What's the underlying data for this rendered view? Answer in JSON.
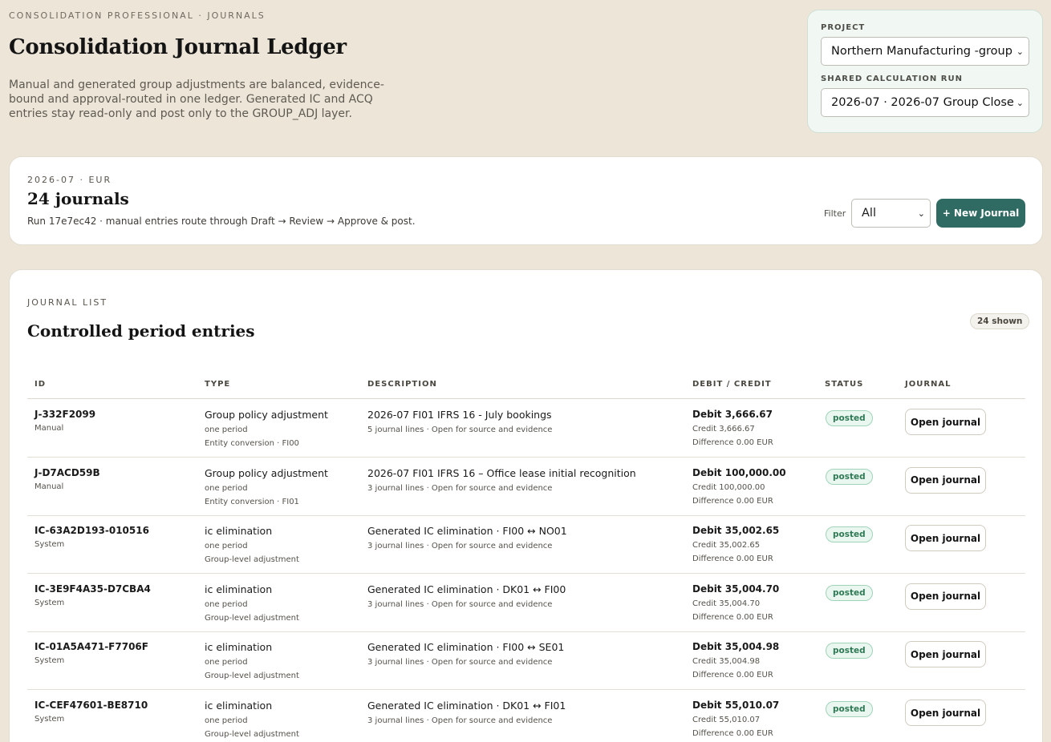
{
  "header": {
    "eyebrow": "CONSOLIDATION PROFESSIONAL · JOURNALS",
    "title": "Consolidation Journal Ledger",
    "intro": "Manual and generated group adjustments are balanced, evidence-bound and approval-routed in one ledger. Generated IC and ACQ entries stay read-only and post only to the GROUP_ADJ layer."
  },
  "project_panel": {
    "project_label": "PROJECT",
    "project_value": "Northern Manufacturing -group",
    "run_label": "SHARED CALCULATION RUN",
    "run_value": "2026-07 · 2026-07 Group Close"
  },
  "summary": {
    "meta": "2026-07 · EUR",
    "count": "24 journals",
    "description": "Run 17e7ec42 · manual entries route through Draft → Review → Approve & post.",
    "filter_label": "Filter",
    "filter_value": "All",
    "new_journal_label": "+ New Journal"
  },
  "journal_list": {
    "eyebrow": "JOURNAL LIST",
    "title": "Controlled period entries",
    "shown_badge": "24 shown",
    "columns": [
      "ID",
      "TYPE",
      "DESCRIPTION",
      "DEBIT / CREDIT",
      "STATUS",
      "JOURNAL"
    ],
    "rows": [
      {
        "id": "J-332F2099",
        "source": "Manual",
        "type": "Group policy adjustment",
        "period": "one period",
        "scope": "Entity conversion · FI00",
        "description": "2026-07 FI01 IFRS 16 - July bookings",
        "detail": "5 journal lines · Open for source and evidence",
        "debit": "Debit 3,666.67",
        "credit": "Credit 3,666.67",
        "difference": "Difference 0.00 EUR",
        "status": "posted",
        "action": "Open journal"
      },
      {
        "id": "J-D7ACD59B",
        "source": "Manual",
        "type": "Group policy adjustment",
        "period": "one period",
        "scope": "Entity conversion · FI01",
        "description": "2026-07 FI01 IFRS 16 – Office lease initial recognition",
        "detail": "3 journal lines · Open for source and evidence",
        "debit": "Debit 100,000.00",
        "credit": "Credit 100,000.00",
        "difference": "Difference 0.00 EUR",
        "status": "posted",
        "action": "Open journal"
      },
      {
        "id": "IC-63A2D193-010516",
        "source": "System",
        "type": "ic elimination",
        "period": "one period",
        "scope": "Group-level adjustment",
        "description": "Generated IC elimination · FI00 ↔ NO01",
        "detail": "3 journal lines · Open for source and evidence",
        "debit": "Debit 35,002.65",
        "credit": "Credit 35,002.65",
        "difference": "Difference 0.00 EUR",
        "status": "posted",
        "action": "Open journal"
      },
      {
        "id": "IC-3E9F4A35-D7CBA4",
        "source": "System",
        "type": "ic elimination",
        "period": "one period",
        "scope": "Group-level adjustment",
        "description": "Generated IC elimination · DK01 ↔ FI00",
        "detail": "3 journal lines · Open for source and evidence",
        "debit": "Debit 35,004.70",
        "credit": "Credit 35,004.70",
        "difference": "Difference 0.00 EUR",
        "status": "posted",
        "action": "Open journal"
      },
      {
        "id": "IC-01A5A471-F7706F",
        "source": "System",
        "type": "ic elimination",
        "period": "one period",
        "scope": "Group-level adjustment",
        "description": "Generated IC elimination · FI00 ↔ SE01",
        "detail": "3 journal lines · Open for source and evidence",
        "debit": "Debit 35,004.98",
        "credit": "Credit 35,004.98",
        "difference": "Difference 0.00 EUR",
        "status": "posted",
        "action": "Open journal"
      },
      {
        "id": "IC-CEF47601-BE8710",
        "source": "System",
        "type": "ic elimination",
        "period": "one period",
        "scope": "Group-level adjustment",
        "description": "Generated IC elimination · DK01 ↔ FI01",
        "detail": "3 journal lines · Open for source and evidence",
        "debit": "Debit 55,010.07",
        "credit": "Credit 55,010.07",
        "difference": "Difference 0.00 EUR",
        "status": "posted",
        "action": "Open journal"
      }
    ]
  }
}
